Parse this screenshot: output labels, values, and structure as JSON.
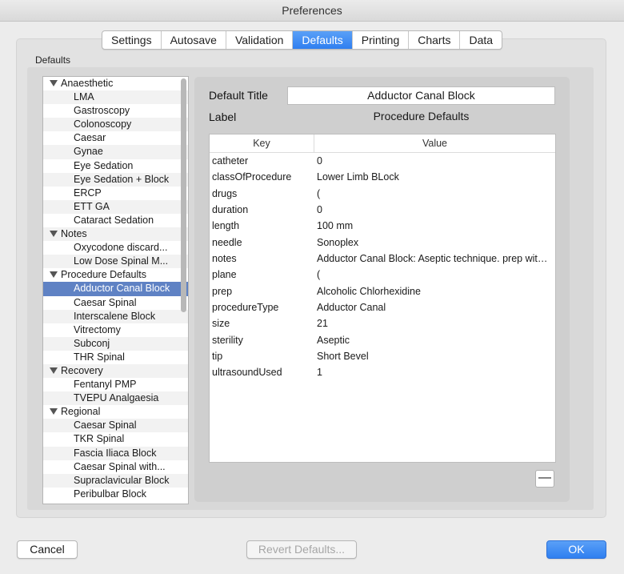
{
  "window": {
    "title": "Preferences"
  },
  "tabs": [
    "Settings",
    "Autosave",
    "Validation",
    "Defaults",
    "Printing",
    "Charts",
    "Data"
  ],
  "active_tab": "Defaults",
  "group_label": "Defaults",
  "sidebar": {
    "rows": [
      {
        "label": "Anaesthetic",
        "type": "group"
      },
      {
        "label": "LMA",
        "type": "item"
      },
      {
        "label": "Gastroscopy",
        "type": "item"
      },
      {
        "label": "Colonoscopy",
        "type": "item"
      },
      {
        "label": "Caesar",
        "type": "item"
      },
      {
        "label": "Gynae",
        "type": "item"
      },
      {
        "label": "Eye Sedation",
        "type": "item"
      },
      {
        "label": "Eye Sedation + Block",
        "type": "item"
      },
      {
        "label": "ERCP",
        "type": "item"
      },
      {
        "label": "ETT GA",
        "type": "item"
      },
      {
        "label": "Cataract Sedation",
        "type": "item"
      },
      {
        "label": "Notes",
        "type": "group"
      },
      {
        "label": "Oxycodone discard...",
        "type": "item"
      },
      {
        "label": "Low Dose Spinal M...",
        "type": "item"
      },
      {
        "label": "Procedure Defaults",
        "type": "group"
      },
      {
        "label": "Adductor Canal Block",
        "type": "item",
        "selected": true
      },
      {
        "label": "Caesar Spinal",
        "type": "item"
      },
      {
        "label": "Interscalene Block",
        "type": "item"
      },
      {
        "label": "Vitrectomy",
        "type": "item"
      },
      {
        "label": "Subconj",
        "type": "item"
      },
      {
        "label": "THR Spinal",
        "type": "item"
      },
      {
        "label": "Recovery",
        "type": "group"
      },
      {
        "label": "Fentanyl PMP",
        "type": "item"
      },
      {
        "label": "TVEPU Analgaesia",
        "type": "item"
      },
      {
        "label": "Regional",
        "type": "group"
      },
      {
        "label": "Caesar Spinal",
        "type": "item"
      },
      {
        "label": "TKR Spinal",
        "type": "item"
      },
      {
        "label": "Fascia Iliaca Block",
        "type": "item"
      },
      {
        "label": "Caesar Spinal with...",
        "type": "item"
      },
      {
        "label": "Supraclavicular Block",
        "type": "item"
      },
      {
        "label": "Peribulbar Block",
        "type": "item"
      }
    ]
  },
  "detail": {
    "default_title_label": "Default Title",
    "default_title_value": "Adductor Canal Block",
    "label_label": "Label",
    "label_value": "Procedure Defaults",
    "table": {
      "headers": [
        "Key",
        "Value"
      ],
      "rows": [
        [
          "catheter",
          "0"
        ],
        [
          "classOfProcedure",
          "Lower Limb BLock"
        ],
        [
          "drugs",
          "("
        ],
        [
          "duration",
          "0"
        ],
        [
          "length",
          "100 mm"
        ],
        [
          "needle",
          "Sonoplex"
        ],
        [
          "notes",
          "Adductor Canal Block: Aseptic technique. prep with Alcoholic Chlorhexidine"
        ],
        [
          "plane",
          "("
        ],
        [
          "prep",
          "Alcoholic Chlorhexidine"
        ],
        [
          "procedureType",
          "Adductor Canal"
        ],
        [
          "size",
          "21"
        ],
        [
          "sterility",
          "Aseptic"
        ],
        [
          "tip",
          "Short Bevel"
        ],
        [
          "ultrasoundUsed",
          "1"
        ]
      ]
    },
    "remove_button_glyph": "—"
  },
  "buttons": {
    "cancel": "Cancel",
    "revert": "Revert Defaults...",
    "ok": "OK"
  },
  "colors": {
    "accent": "#2f7ff0",
    "selection": "#5f82c4"
  }
}
